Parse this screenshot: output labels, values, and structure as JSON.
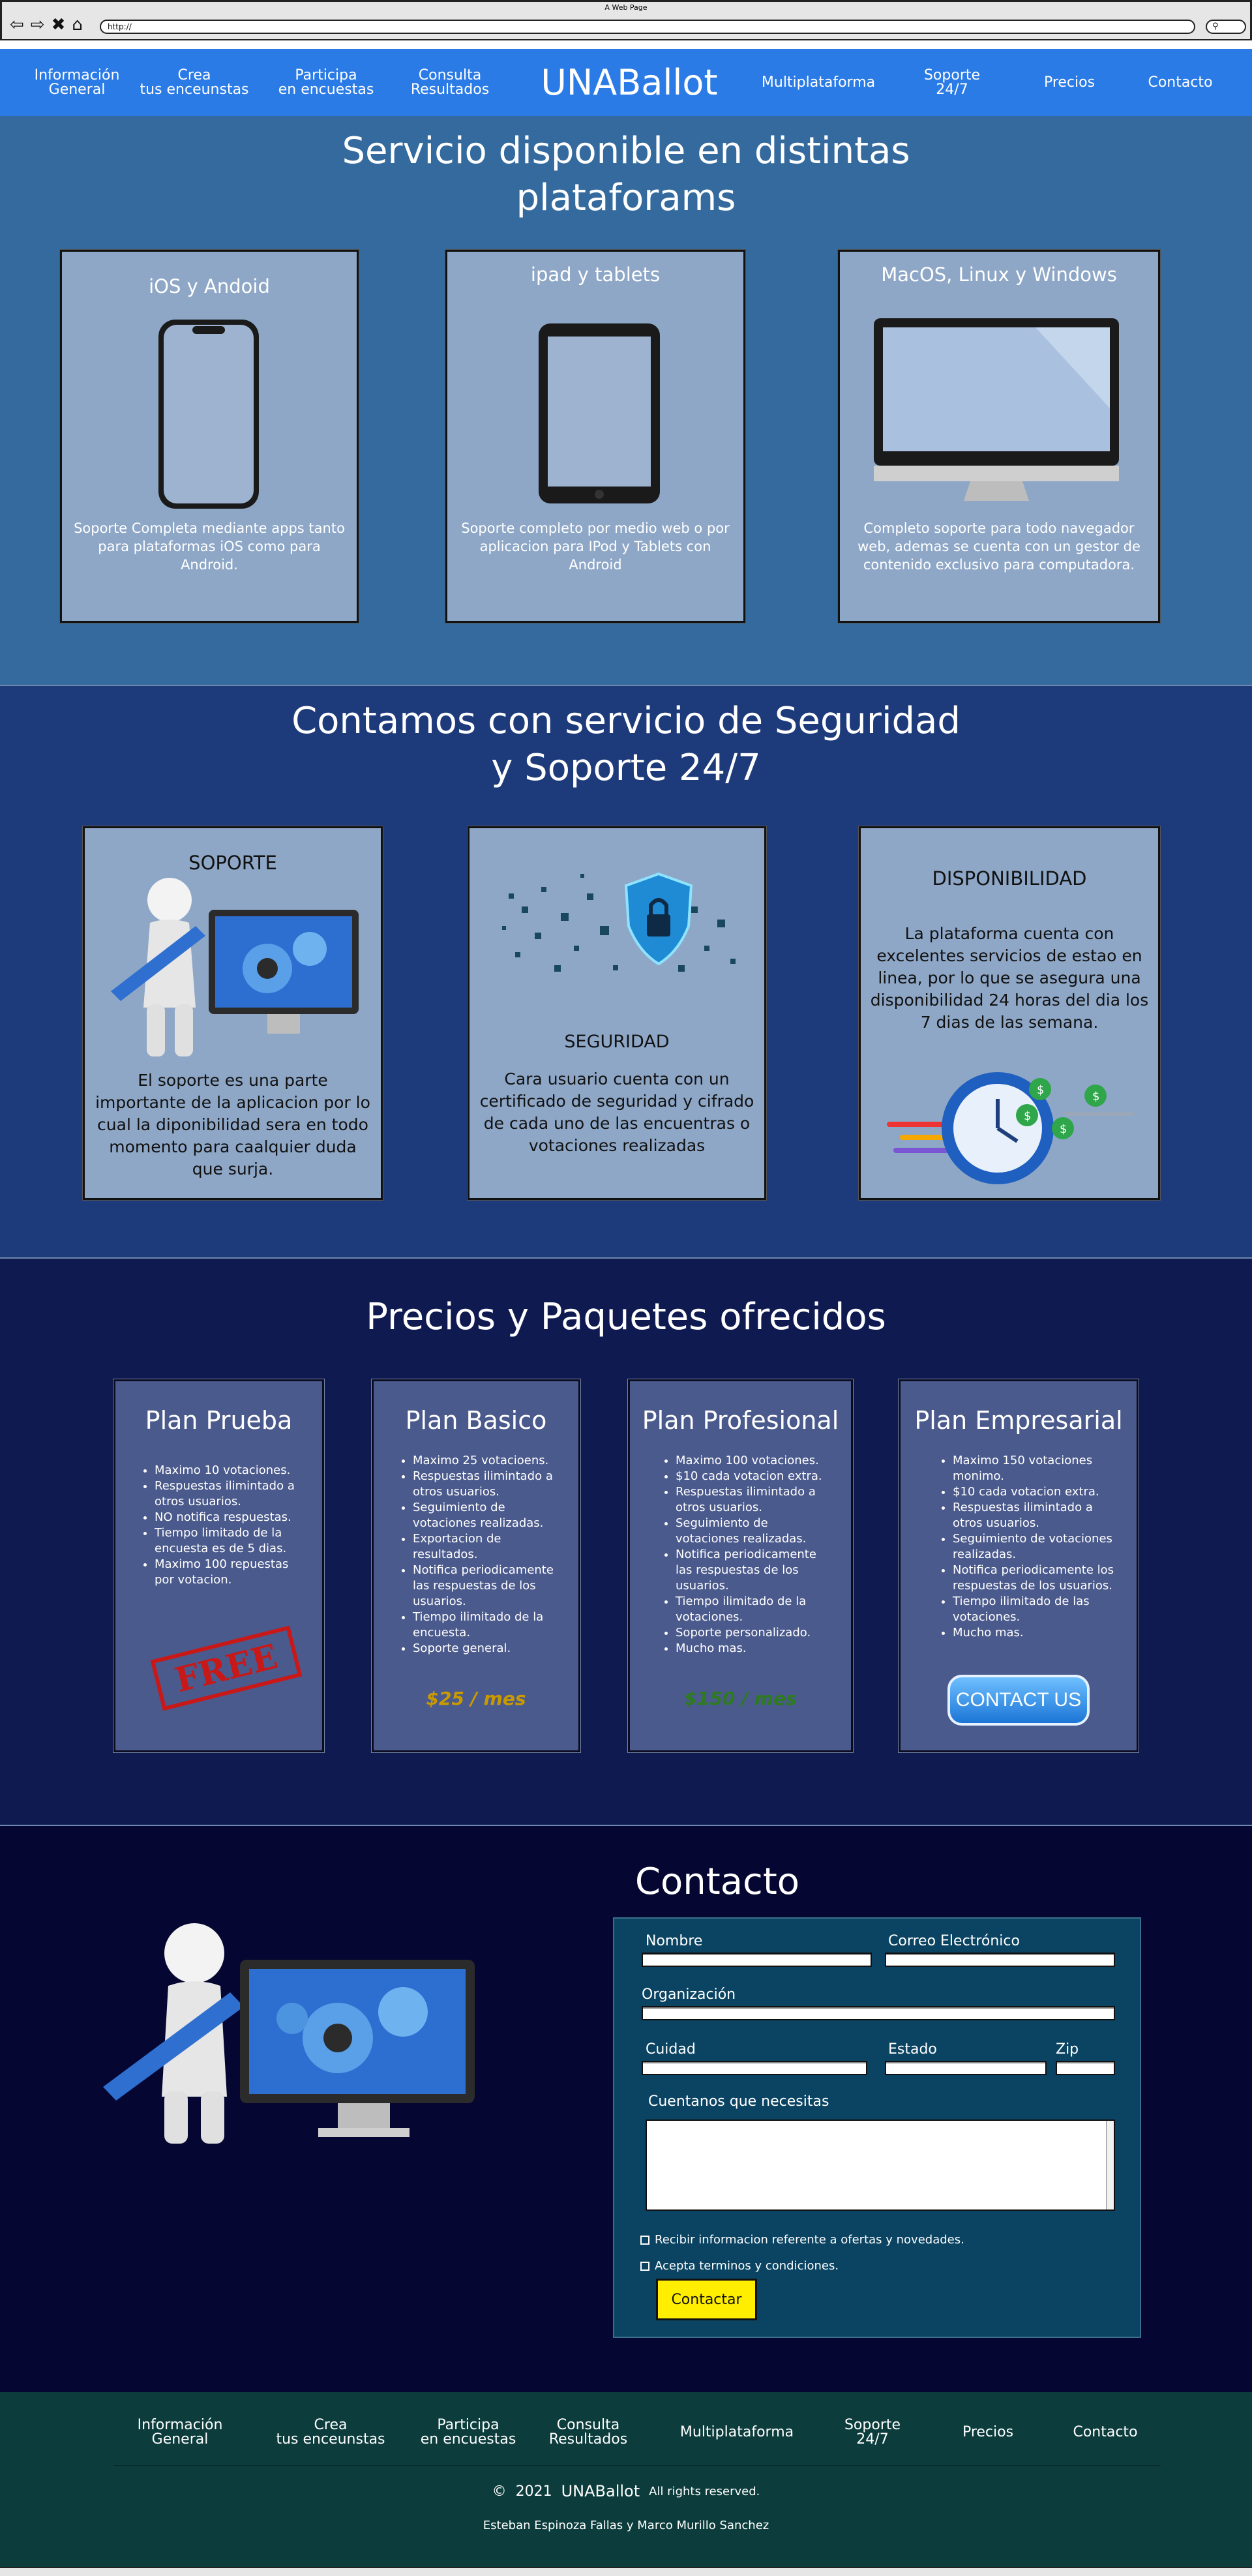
{
  "window": {
    "title": "A Web Page",
    "url": "http://",
    "search_icon": "search-icon"
  },
  "nav": {
    "brand": "UNABallot",
    "items": [
      "Información\nGeneral",
      "Crea\ntus enceunstas",
      "Participa\nen encuestas",
      "Consulta\nResultados",
      "Multiplataforma",
      "Soporte\n24/7",
      "Precios",
      "Contacto"
    ]
  },
  "platforms": {
    "title": "Servicio disponible en distintas\nplataforams",
    "cards": [
      {
        "title": "iOS y Andoid",
        "text": "Soporte Completa mediante apps tanto para plataformas iOS como para Android.",
        "icon": "smartphone-icon"
      },
      {
        "title": "ipad y tablets",
        "text": "Soporte completo por medio web o por aplicacion para IPod y Tablets con Android",
        "icon": "tablet-icon"
      },
      {
        "title": "MacOS, Linux y Windows",
        "text": "Completo soporte para todo navegador web, ademas se cuenta con un gestor de contenido exclusivo para computadora.",
        "icon": "desktop-monitor-icon"
      }
    ]
  },
  "security": {
    "title": "Contamos con servicio de Seguridad\ny Soporte 24/7",
    "cards": [
      {
        "title": "SOPORTE",
        "text": "El soporte es una parte importante de la aplicacion por lo cual la diponibilidad sera en todo momento para caalquier duda que surja."
      },
      {
        "title": "SEGURIDAD",
        "text": "Cara usuario cuenta con un certificado de seguridad y cifrado de cada uno de las encuentras o votaciones realizadas"
      },
      {
        "title": "DISPONIBILIDAD",
        "text": "La plataforma cuenta con excelentes servicios de estao en linea, por lo que se asegura una disponibilidad 24 horas del dia los 7 dias de las semana."
      }
    ]
  },
  "pricing": {
    "title": "Precios y Paquetes ofrecidos",
    "plans": [
      {
        "name": "Plan Prueba",
        "features": [
          "Maximo 10 votaciones.",
          "Respuestas ilimintado a otros usuarios.",
          "NO notifica respuestas.",
          "Tiempo limitado de la encuesta es de 5 dias.",
          "Maximo 100 repuestas por votacion."
        ],
        "stamp": "FREE"
      },
      {
        "name": "Plan Basico",
        "features": [
          "Maximo 25 votacioens.",
          "Respuestas ilimintado a otros usuarios.",
          "Seguimiento de votaciones realizadas.",
          "Exportacion de resultados.",
          "Notifica periodicamente las respuestas de los usuarios.",
          "Tiempo ilimitado de la encuesta.",
          "Soporte general."
        ],
        "price": "$25 / mes",
        "price_color": "#c99a00"
      },
      {
        "name": "Plan Profesional",
        "features": [
          "Maximo 100 votaciones.",
          "$10 cada votacion extra.",
          "Respuestas ilimintado a otros usuarios.",
          "Seguimiento de votaciones realizadas.",
          "Notifica periodicamente las respuestas de los usuarios.",
          "Tiempo ilimitado de la votaciones.",
          "Soporte personalizado.",
          "Mucho mas."
        ],
        "price": "$150 / mes",
        "price_color": "#2d7a1f"
      },
      {
        "name": "Plan Empresarial",
        "features": [
          "Maximo 150 votaciones monimo.",
          "$10 cada votacion extra.",
          "Respuestas ilimintado a otros usuarios.",
          "Seguimiento de votaciones realizadas.",
          "Notifica periodicamente los respuestas de los usuarios.",
          "Tiempo ilimitado de las votaciones.",
          "Mucho mas."
        ],
        "cta": "CONTACT US"
      }
    ]
  },
  "contact": {
    "title": "Contacto",
    "form": {
      "name_label": "Nombre",
      "email_label": "Correo Electrónico",
      "org_label": "Organización",
      "city_label": "Cuidad",
      "state_label": "Estado",
      "zip_label": "Zip",
      "needs_label": "Cuentanos que necesitas",
      "offers_checkbox": "Recibir informacion referente a ofertas y novedades.",
      "terms_checkbox": "Acepta terminos y condiciones.",
      "submit": "Contactar"
    }
  },
  "footer": {
    "items": [
      "Información\nGeneral",
      "Crea\ntus enceunstas",
      "Participa\nen encuestas",
      "Consulta\nResultados",
      "Multiplataforma",
      "Soporte\n24/7",
      "Precios",
      "Contacto"
    ],
    "copyright_symbol": "©",
    "year": "2021",
    "brand": "UNABallot",
    "rights": "All rights reserved.",
    "authors": "Esteban Espinoza Fallas y Marco Murillo Sanchez"
  }
}
